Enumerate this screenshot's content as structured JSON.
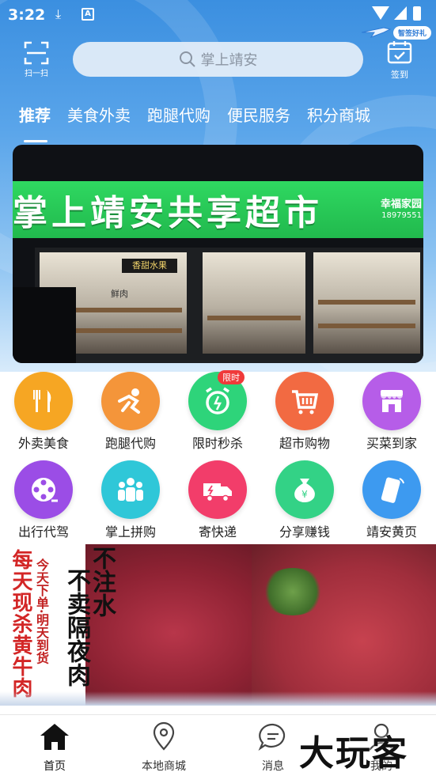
{
  "status_bar": {
    "time": "3:22"
  },
  "header": {
    "scan_label": "扫一扫",
    "search_placeholder": "掌上靖安",
    "signin_label": "签到",
    "promo_text": "智签好礼"
  },
  "tabs": [
    {
      "label": "推荐",
      "active": true
    },
    {
      "label": "美食外卖"
    },
    {
      "label": "跑腿代购"
    },
    {
      "label": "便民服务"
    },
    {
      "label": "积分商城"
    }
  ],
  "banner": {
    "sign_text": "掌上靖安共享超市",
    "sign_sub": "幸福家园",
    "sign_phone": "18979551",
    "inner_sign": "香甜水果",
    "inner_label": "鲜肉"
  },
  "quick_grid": [
    {
      "label": "外卖美食",
      "icon": "fork-knife-icon",
      "color": "#f6a623"
    },
    {
      "label": "跑腿代购",
      "icon": "runner-icon",
      "color": "#f4953a"
    },
    {
      "label": "限时秒杀",
      "icon": "alarm-clock-icon",
      "color": "#2ed47a",
      "badge": "限时"
    },
    {
      "label": "超市购物",
      "icon": "shopping-cart-icon",
      "color": "#f26a42"
    },
    {
      "label": "买菜到家",
      "icon": "storefront-icon",
      "color": "#b65de8"
    },
    {
      "label": "出行代驾",
      "icon": "film-reel-icon",
      "color": "#9b4de6"
    },
    {
      "label": "掌上拼购",
      "icon": "group-icon",
      "color": "#2fc7d8"
    },
    {
      "label": "寄快递",
      "icon": "delivery-truck-icon",
      "color": "#f23d6a"
    },
    {
      "label": "分享赚钱",
      "icon": "money-bag-icon",
      "color": "#33d286"
    },
    {
      "label": "靖安黄页",
      "icon": "phone-icon",
      "color": "#3d9af0"
    }
  ],
  "promo": {
    "col1": "每天现杀黄牛肉",
    "col2": "今天下单·明天到货",
    "col3": "不注水",
    "col4": "不卖隔夜肉"
  },
  "bottom_nav": [
    {
      "label": "首页",
      "icon": "home-icon",
      "active": true
    },
    {
      "label": "本地商城",
      "icon": "location-pin-icon"
    },
    {
      "label": "消息",
      "icon": "chat-bubble-icon"
    },
    {
      "label": "我的",
      "icon": "user-icon"
    }
  ],
  "watermark": "大玩客"
}
